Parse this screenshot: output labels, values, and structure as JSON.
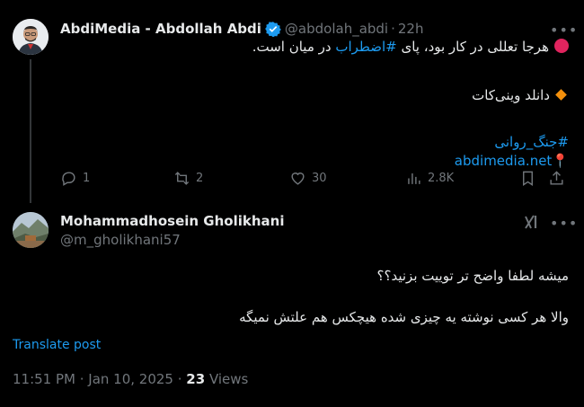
{
  "tweet": {
    "display_name": "AbdiMedia - Abdollah Abdi",
    "handle": "@abdolah_abdi",
    "time": "22h",
    "line1_text": "هرجا تعللی در کار بود، پای",
    "line1_hashtag": "#اضطراب",
    "line1_text_end": "در میان است.",
    "line2_text": "دانلد وینی‌کات",
    "hashtag2": "#جنگ_روانی",
    "link": "abdimedia.net",
    "replies": "1",
    "retweets": "2",
    "likes": "30",
    "views": "2.8K"
  },
  "reply": {
    "display_name": "Mohammadhosein Gholikhani",
    "handle": "@m_gholikhani57",
    "line1": "میشه لطفا واضح تر توییت بزنید؟؟",
    "line2": "والا هر کسی نوشته یه چیزی شده هیچکس هم علتش نمیگه",
    "translate": "Translate post",
    "timestamp": "11:51 PM · Jan 10, 2025 · ",
    "views_count": "23",
    "views_label": "Views"
  },
  "colors": {
    "background": "#000000",
    "text": "#e7e9ea",
    "muted": "#71767b",
    "accent": "#1d9bf0"
  }
}
